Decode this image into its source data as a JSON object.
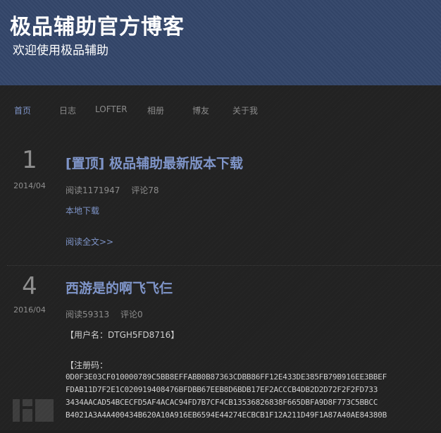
{
  "header": {
    "title": "极品辅助官方博客",
    "subtitle": "欢迎使用极品辅助"
  },
  "nav": {
    "items": [
      "首页",
      "日志",
      "LOFTER",
      "相册",
      "博友",
      "关于我"
    ],
    "active_index": 0
  },
  "posts": [
    {
      "day": "1",
      "month": "2014/04",
      "title": "[置顶] 极品辅助最新版本下载",
      "reads": "阅读1171947",
      "comments": "评论78",
      "link": "本地下载",
      "read_more": "阅读全文>>"
    },
    {
      "day": "4",
      "month": "2016/04",
      "title": "西游是的啊飞飞仨",
      "reads": "阅读59313",
      "comments": "评论0",
      "username_line": "【用户名：DTGH5FD8716】",
      "regcode_label": "【注册码：",
      "regcode_lines": [
        "0D0F3E03CF010000789C5BB8EFFABB0B87363CDBB86FF12E433DE385FB79B916EE3BBEF",
        "FDAB11D7F2E1C020919408476BFDBB67EEB8D6BDB17EF2ACCCB4DB2D2D72F2F2FD733",
        "3434AACAD54BCECFD5AF4ACAC94FD7B7CF4CB13536826838F665DBFA9D8F773C5BBCC",
        "B4021A3A4A400434B620A10A916EB6594E44274ECBCB1F12A211D49F1A87A40AE84380B"
      ]
    }
  ],
  "colors": {
    "header_bg": "#34476b",
    "page_bg": "#222222",
    "link": "#7f95c9",
    "muted": "#8c8c8c"
  }
}
